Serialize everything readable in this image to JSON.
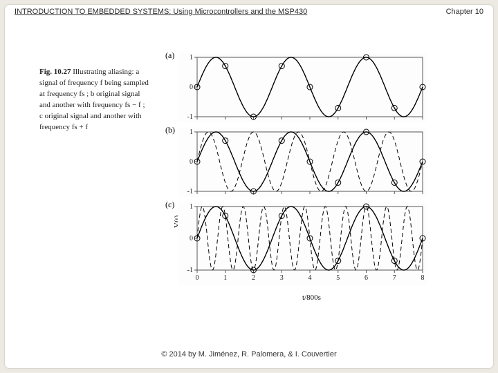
{
  "header": {
    "title": "INTRODUCTION TO EMBEDDED SYSTEMS: Using Microcontrollers and the MSP430",
    "chapter": "Chapter 10"
  },
  "figure": {
    "caption_lead": "Fig. 10.27",
    "caption_rest": "  Illustrating aliasing: a signal of frequency  f  being sampled at frequency fs ; b original signal and another with frequency fs − f ; c original signal and another with frequency fs + f",
    "panels": [
      {
        "label": "(a)"
      },
      {
        "label": "(b)"
      },
      {
        "label": "(c)"
      }
    ],
    "xlabel": "t/800s",
    "ylabel": "V(t)"
  },
  "chart_data": [
    {
      "type": "line",
      "title": "(a)",
      "xlabel": "",
      "ylabel": "",
      "xlim": [
        0,
        8
      ],
      "ylim": [
        -1,
        1
      ],
      "xticks": [
        0,
        1,
        2,
        3,
        4,
        5,
        6,
        7,
        8
      ],
      "yticks": [
        -1,
        0,
        1
      ],
      "series": [
        {
          "name": "signal f",
          "style": "solid",
          "function": "sin(2*pi*0.375*x)"
        }
      ],
      "samples": {
        "x": [
          0,
          1,
          2,
          3,
          4,
          5,
          6,
          7,
          8
        ],
        "y": [
          0.0,
          0.707,
          -1.0,
          0.707,
          0.0,
          -0.707,
          1.0,
          -0.707,
          0.0
        ]
      }
    },
    {
      "type": "line",
      "title": "(b)",
      "xlabel": "",
      "ylabel": "",
      "xlim": [
        0,
        8
      ],
      "ylim": [
        -1,
        1
      ],
      "xticks": [
        0,
        1,
        2,
        3,
        4,
        5,
        6,
        7,
        8
      ],
      "yticks": [
        -1,
        0,
        1
      ],
      "series": [
        {
          "name": "signal f",
          "style": "solid",
          "function": "sin(2*pi*0.375*x)"
        },
        {
          "name": "signal fs - f",
          "style": "dashed",
          "function": "sin(2*pi*0.625*x)"
        }
      ],
      "samples": {
        "x": [
          0,
          1,
          2,
          3,
          4,
          5,
          6,
          7,
          8
        ],
        "y": [
          0.0,
          0.707,
          -1.0,
          0.707,
          0.0,
          -0.707,
          1.0,
          -0.707,
          0.0
        ]
      }
    },
    {
      "type": "line",
      "title": "(c)",
      "xlabel": "t/800s",
      "ylabel": "V(t)",
      "xlim": [
        0,
        8
      ],
      "ylim": [
        -1,
        1
      ],
      "xticks": [
        0,
        1,
        2,
        3,
        4,
        5,
        6,
        7,
        8
      ],
      "yticks": [
        -1,
        0,
        1
      ],
      "series": [
        {
          "name": "signal f",
          "style": "solid",
          "function": "sin(2*pi*0.375*x)"
        },
        {
          "name": "signal fs + f",
          "style": "dashed",
          "function": "sin(2*pi*1.375*x)"
        }
      ],
      "samples": {
        "x": [
          0,
          1,
          2,
          3,
          4,
          5,
          6,
          7,
          8
        ],
        "y": [
          0.0,
          0.707,
          -1.0,
          0.707,
          0.0,
          -0.707,
          1.0,
          -0.707,
          0.0
        ]
      }
    }
  ],
  "footer": "© 2014 by M. Jiménez, R. Palomera, & I. Couvertier"
}
